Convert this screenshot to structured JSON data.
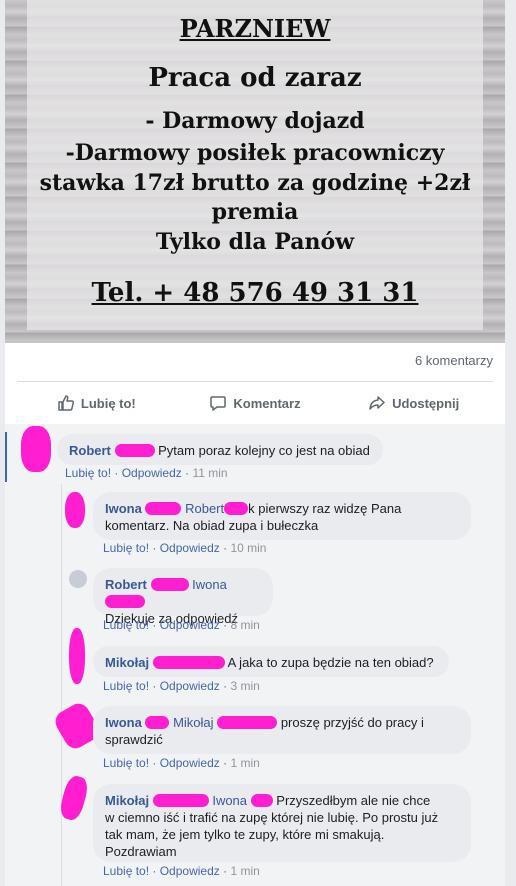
{
  "poster": {
    "title": "PARZNIEW",
    "headline": "Praca od zaraz",
    "lines": [
      "- Darmowy dojazd",
      "-Darmowy posiłek pracowniczy",
      "stawka 17zł brutto za godzinę +2zł",
      "premia",
      "Tylko dla Panów"
    ],
    "phone": "Tel. + 48 576 49 31 31"
  },
  "comment_count": "6 komentarzy",
  "actions": {
    "like": "Lubię to!",
    "comment": "Komentarz",
    "share": "Udostępnij"
  },
  "colors": {
    "link": "#385898",
    "accent": "#4267b2",
    "redaction": "#ff1fd0"
  },
  "comments": [
    {
      "author": "Robert",
      "text": "Pytam poraz kolejny co jest na obiad",
      "like": "Lubię to!",
      "reply": "Odpowiedz",
      "time": "11 min"
    },
    {
      "author": "Iwona",
      "tag": "Robert",
      "tag_tail": "k",
      "text_line1": "pierwszy raz widzę Pana",
      "text_line2": "komentarz. Na obiad zupa i bułeczka",
      "like": "Lubię to!",
      "reply": "Odpowiedz",
      "time": "10 min"
    },
    {
      "author": "Robert",
      "tag": "Iwona",
      "text": "Dziekuje za odpowiedź",
      "like": "Lubię to!",
      "reply": "Odpowiedz",
      "time": "8 min"
    },
    {
      "author": "Mikołaj",
      "text": "A jaka to zupa będzie na ten obiad?",
      "like": "Lubię to!",
      "reply": "Odpowiedz",
      "time": "3 min"
    },
    {
      "author": "Iwona",
      "tag": "Mikołaj",
      "text_line1": "proszę przyjść do pracy i",
      "text_line2": "sprawdzić",
      "like": "Lubię to!",
      "reply": "Odpowiedz",
      "time": "1 min"
    },
    {
      "author": "Mikołaj",
      "tag": "Iwona",
      "text_line1": "Przyszedłbym ale nie chce",
      "text_line2": "w ciemno iść i trafić na zupę której nie lubię. Po prostu już",
      "text_line3": "tak mam, że jem tylko te zupy, które mi smakują.",
      "text_line4": "Pozdrawiam",
      "like": "Lubię to!",
      "reply": "Odpowiedz",
      "time": "1 min"
    }
  ]
}
